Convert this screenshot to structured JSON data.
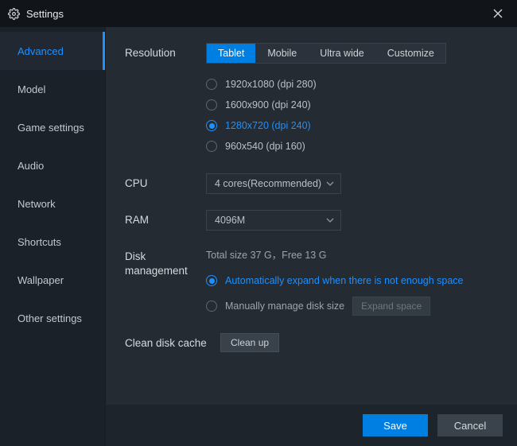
{
  "title": "Settings",
  "sidebar": [
    "Advanced",
    "Model",
    "Game settings",
    "Audio",
    "Network",
    "Shortcuts",
    "Wallpaper",
    "Other settings"
  ],
  "resolution": {
    "label": "Resolution",
    "tabs": [
      "Tablet",
      "Mobile",
      "Ultra wide",
      "Customize"
    ],
    "selected_tab": "Tablet",
    "options": [
      "1920x1080  (dpi 280)",
      "1600x900  (dpi 240)",
      "1280x720  (dpi 240)",
      "960x540  (dpi 160)"
    ],
    "selected_option": "1280x720  (dpi 240)"
  },
  "cpu": {
    "label": "CPU",
    "value": "4 cores(Recommended)"
  },
  "ram": {
    "label": "RAM",
    "value": "4096M"
  },
  "disk": {
    "label": "Disk management",
    "info": "Total size 37 G，Free 13 G",
    "options": [
      "Automatically expand when there is not enough space",
      "Manually manage disk size"
    ],
    "selected_option": "Automatically expand when there is not enough space",
    "expand_btn": "Expand space"
  },
  "clean": {
    "label": "Clean disk cache",
    "btn": "Clean up"
  },
  "footer": {
    "save": "Save",
    "cancel": "Cancel"
  },
  "colors": {
    "accent": "#007fe3",
    "bg": "#242b33",
    "sidebar": "#1b2128",
    "titlebar": "#111418"
  }
}
